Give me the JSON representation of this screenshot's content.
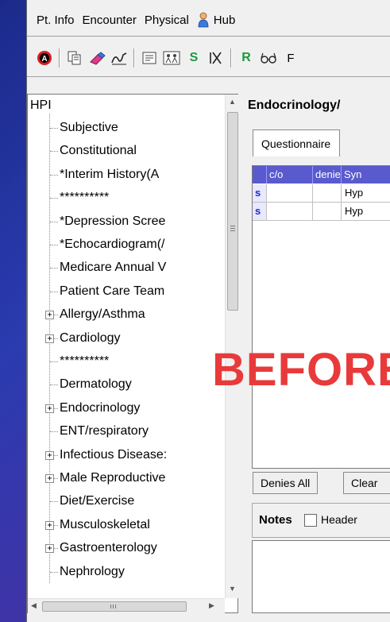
{
  "menu": {
    "items": [
      "Pt. Info",
      "Encounter",
      "Physical",
      "Hub"
    ]
  },
  "toolbar": {
    "glyph_s": "S",
    "glyph_r": "R",
    "glyph_f": "F"
  },
  "tree": {
    "root": "HPI",
    "items": [
      {
        "label": "Subjective",
        "expandable": false
      },
      {
        "label": "Constitutional",
        "expandable": false
      },
      {
        "label": "*Interim History(A",
        "expandable": false
      },
      {
        "label": "**********",
        "expandable": false
      },
      {
        "label": "*Depression Scree",
        "expandable": false
      },
      {
        "label": "*Echocardiogram(/",
        "expandable": false
      },
      {
        "label": "Medicare Annual V",
        "expandable": false
      },
      {
        "label": "Patient Care Team",
        "expandable": false
      },
      {
        "label": "Allergy/Asthma",
        "expandable": true
      },
      {
        "label": "Cardiology",
        "expandable": true
      },
      {
        "label": "**********",
        "expandable": false
      },
      {
        "label": "Dermatology",
        "expandable": false
      },
      {
        "label": "Endocrinology",
        "expandable": true
      },
      {
        "label": "ENT/respiratory",
        "expandable": false
      },
      {
        "label": "Infectious Disease:",
        "expandable": true
      },
      {
        "label": "Male Reproductive",
        "expandable": true
      },
      {
        "label": "Diet/Exercise",
        "expandable": false
      },
      {
        "label": "Musculoskeletal",
        "expandable": true
      },
      {
        "label": "Gastroenterology",
        "expandable": true
      },
      {
        "label": "Nephrology",
        "expandable": false
      }
    ]
  },
  "panel": {
    "title": "Endocrinology/",
    "tab": "Questionnaire",
    "columns": [
      "c/o",
      "denie",
      "Syn"
    ],
    "rows": [
      {
        "flag": "s",
        "co": "",
        "denies": "",
        "symptom": "Hyp"
      },
      {
        "flag": "s",
        "co": "",
        "denies": "",
        "symptom": "Hyp"
      }
    ],
    "denies_all": "Denies All",
    "clear": "Clear",
    "notes_label": "Notes",
    "header_label": "Header"
  },
  "overlay": {
    "text": "BEFORE",
    "color": "#e83a3a"
  }
}
